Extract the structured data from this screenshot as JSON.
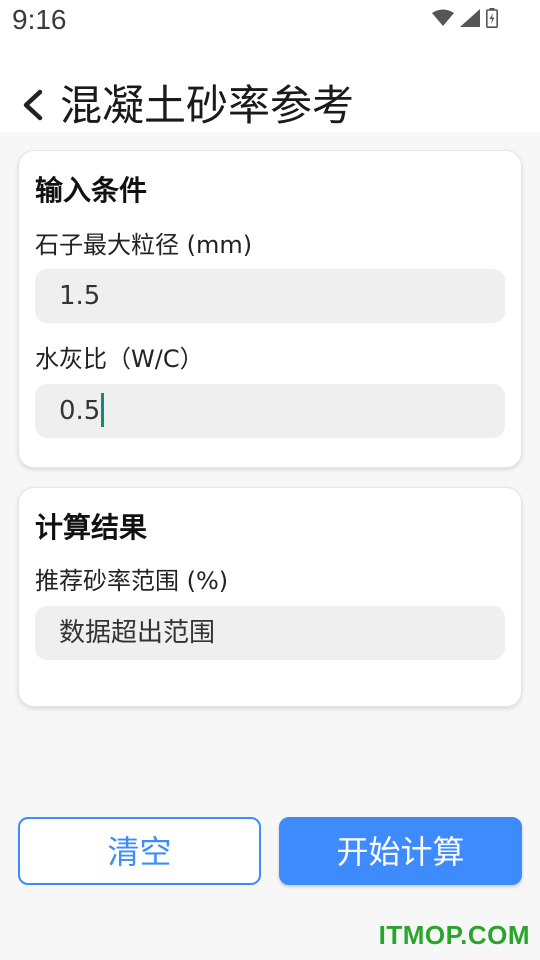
{
  "status": {
    "time": "9:16",
    "icons": [
      "wifi-icon",
      "signal-icon",
      "battery-icon"
    ]
  },
  "header": {
    "back_icon": "back-arrow-icon",
    "title": "混凝土砂率参考"
  },
  "input_card": {
    "title": "输入条件",
    "stone_size_label": "石子最大粒径 (mm)",
    "stone_size_value": "1.5",
    "wc_ratio_label": "水灰比（W/C）",
    "wc_ratio_value": "0.5"
  },
  "result_card": {
    "title": "计算结果",
    "sand_ratio_label": "推荐砂率范围 (%)",
    "sand_ratio_value": "数据超出范围"
  },
  "buttons": {
    "clear_label": "清空",
    "calc_label": "开始计算"
  },
  "watermark": "ITMOP.COM",
  "colors": {
    "accent": "#3d8bfd",
    "cursor": "#138a72",
    "field_bg": "#efefef",
    "watermark": "#2aa52a"
  }
}
